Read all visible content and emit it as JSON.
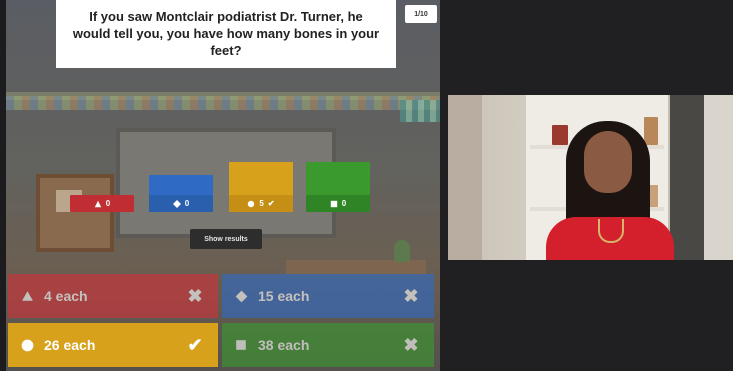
{
  "question": {
    "text": "If you saw Montclair podiatrist Dr. Turner, he would tell you, you have how many bones in your feet?",
    "counter": "1/10"
  },
  "results": {
    "show_label": "Show results",
    "bars": [
      {
        "count": "0",
        "color": "#d0323a",
        "icon": "triangle-icon",
        "correct": false
      },
      {
        "count": "0",
        "color": "#2f6bc4",
        "icon": "diamond-icon",
        "correct": false
      },
      {
        "count": "5",
        "color": "#d8a11c",
        "icon": "circle-icon",
        "correct": true
      },
      {
        "count": "0",
        "color": "#3a9a2e",
        "icon": "square-icon",
        "correct": false
      }
    ]
  },
  "answers": [
    {
      "label": "4 each",
      "color": "#d0323a",
      "icon": "triangle-icon",
      "mark": "✖",
      "correct": false
    },
    {
      "label": "15 each",
      "color": "#2f6bc4",
      "icon": "diamond-icon",
      "mark": "✖",
      "correct": false
    },
    {
      "label": "26 each",
      "color": "#d8a11c",
      "icon": "circle-icon",
      "mark": "✔",
      "correct": true
    },
    {
      "label": "38 each",
      "color": "#3a9a2e",
      "icon": "square-icon",
      "mark": "✖",
      "correct": false
    }
  ]
}
